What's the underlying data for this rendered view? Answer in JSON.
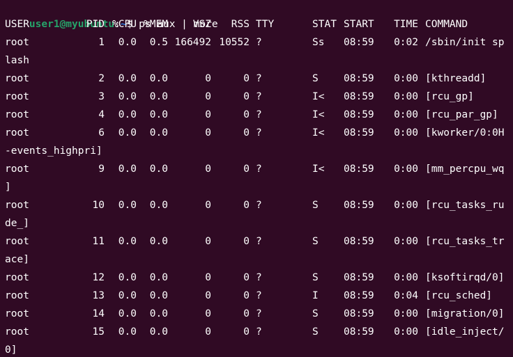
{
  "terminal": {
    "prompt": {
      "user_host": "user1@myubuntu",
      "separator": ":",
      "path": "~",
      "symbol": "$",
      "command": "ps aux | more"
    },
    "header": [
      "USER",
      "PID",
      "%CPU",
      "%MEM",
      "VSZ",
      "RSS",
      "TTY",
      "STAT",
      "START",
      "TIME",
      "COMMAND"
    ],
    "rows": [
      {
        "user": "root",
        "pid": "1",
        "cpu": "0.0",
        "mem": "0.5",
        "vsz": "166492",
        "rss": "10552",
        "tty": "?",
        "stat": "Ss",
        "start": "08:59",
        "time": "0:02",
        "command": "/sbin/init sp",
        "wrap": "lash"
      },
      {
        "user": "root",
        "pid": "2",
        "cpu": "0.0",
        "mem": "0.0",
        "vsz": "0",
        "rss": "0",
        "tty": "?",
        "stat": "S",
        "start": "08:59",
        "time": "0:00",
        "command": "[kthreadd]",
        "wrap": ""
      },
      {
        "user": "root",
        "pid": "3",
        "cpu": "0.0",
        "mem": "0.0",
        "vsz": "0",
        "rss": "0",
        "tty": "?",
        "stat": "I<",
        "start": "08:59",
        "time": "0:00",
        "command": "[rcu_gp]",
        "wrap": ""
      },
      {
        "user": "root",
        "pid": "4",
        "cpu": "0.0",
        "mem": "0.0",
        "vsz": "0",
        "rss": "0",
        "tty": "?",
        "stat": "I<",
        "start": "08:59",
        "time": "0:00",
        "command": "[rcu_par_gp]",
        "wrap": ""
      },
      {
        "user": "root",
        "pid": "6",
        "cpu": "0.0",
        "mem": "0.0",
        "vsz": "0",
        "rss": "0",
        "tty": "?",
        "stat": "I<",
        "start": "08:59",
        "time": "0:00",
        "command": "[kworker/0:0H",
        "wrap": "-events_highpri]"
      },
      {
        "user": "root",
        "pid": "9",
        "cpu": "0.0",
        "mem": "0.0",
        "vsz": "0",
        "rss": "0",
        "tty": "?",
        "stat": "I<",
        "start": "08:59",
        "time": "0:00",
        "command": "[mm_percpu_wq",
        "wrap": "]"
      },
      {
        "user": "root",
        "pid": "10",
        "cpu": "0.0",
        "mem": "0.0",
        "vsz": "0",
        "rss": "0",
        "tty": "?",
        "stat": "S",
        "start": "08:59",
        "time": "0:00",
        "command": "[rcu_tasks_ru",
        "wrap": "de_]"
      },
      {
        "user": "root",
        "pid": "11",
        "cpu": "0.0",
        "mem": "0.0",
        "vsz": "0",
        "rss": "0",
        "tty": "?",
        "stat": "S",
        "start": "08:59",
        "time": "0:00",
        "command": "[rcu_tasks_tr",
        "wrap": "ace]"
      },
      {
        "user": "root",
        "pid": "12",
        "cpu": "0.0",
        "mem": "0.0",
        "vsz": "0",
        "rss": "0",
        "tty": "?",
        "stat": "S",
        "start": "08:59",
        "time": "0:00",
        "command": "[ksoftirqd/0]",
        "wrap": ""
      },
      {
        "user": "root",
        "pid": "13",
        "cpu": "0.0",
        "mem": "0.0",
        "vsz": "0",
        "rss": "0",
        "tty": "?",
        "stat": "I",
        "start": "08:59",
        "time": "0:04",
        "command": "[rcu_sched]",
        "wrap": ""
      },
      {
        "user": "root",
        "pid": "14",
        "cpu": "0.0",
        "mem": "0.0",
        "vsz": "0",
        "rss": "0",
        "tty": "?",
        "stat": "S",
        "start": "08:59",
        "time": "0:00",
        "command": "[migration/0]",
        "wrap": ""
      },
      {
        "user": "root",
        "pid": "15",
        "cpu": "0.0",
        "mem": "0.0",
        "vsz": "0",
        "rss": "0",
        "tty": "?",
        "stat": "S",
        "start": "08:59",
        "time": "0:00",
        "command": "[idle_inject/",
        "wrap": "0]"
      }
    ],
    "colors": {
      "background": "#300a24",
      "foreground": "#ffffff",
      "prompt_user": "#26a269",
      "prompt_path": "#2a7bde"
    }
  }
}
